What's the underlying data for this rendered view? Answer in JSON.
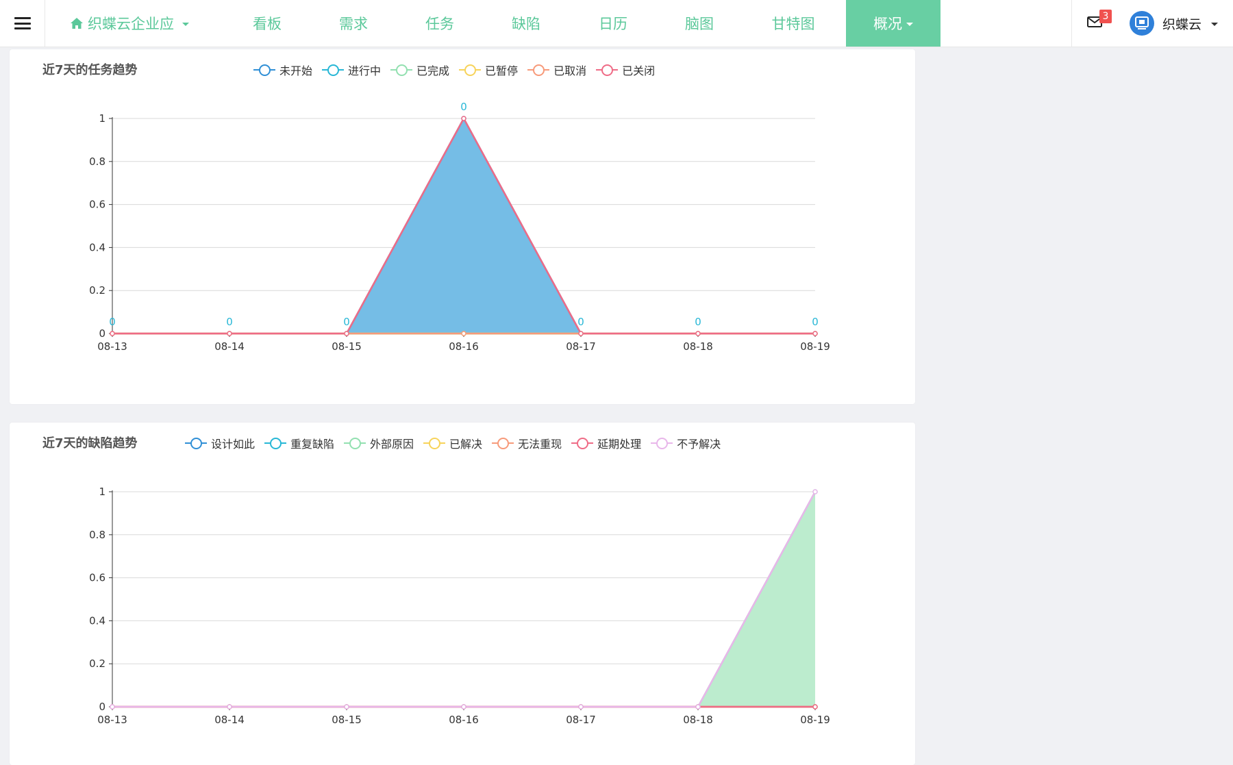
{
  "nav": {
    "app_name": "织蝶云企业应",
    "tabs": [
      "看板",
      "需求",
      "任务",
      "缺陷",
      "日历",
      "脑图",
      "甘特图"
    ],
    "active_tab": "概况",
    "notifications_count": "3",
    "username": "织蝶云"
  },
  "colors": {
    "accent": "#5bc89a",
    "active_tab_bg": "#68cfa3"
  },
  "task_card": {
    "title": "近7天的任务趋势"
  },
  "defect_card": {
    "title": "近7天的缺陷趋势"
  },
  "chart_data": [
    {
      "type": "area",
      "title": "近7天的任务趋势",
      "categories": [
        "08-13",
        "08-14",
        "08-15",
        "08-16",
        "08-17",
        "08-18",
        "08-19"
      ],
      "ylim": [
        0,
        1
      ],
      "yticks": [
        "0",
        "0.2",
        "0.4",
        "0.6",
        "0.8",
        "1"
      ],
      "grid": true,
      "legend_position": "top",
      "series": [
        {
          "name": "未开始",
          "color": "#2f8fd6",
          "values": [
            0,
            0,
            0,
            1,
            0,
            0,
            0
          ],
          "fill": "#75bde6"
        },
        {
          "name": "进行中",
          "color": "#27b7d6",
          "values": [
            0,
            0,
            0,
            0,
            0,
            0,
            0
          ]
        },
        {
          "name": "已完成",
          "color": "#92e0b0",
          "values": [
            0,
            0,
            0,
            0,
            0,
            0,
            0
          ]
        },
        {
          "name": "已暂停",
          "color": "#f7d35a",
          "values": [
            0,
            0,
            0,
            0,
            0,
            0,
            0
          ]
        },
        {
          "name": "已取消",
          "color": "#f79a7a",
          "values": [
            0,
            0,
            0,
            0,
            0,
            0,
            0
          ]
        },
        {
          "name": "已关闭",
          "color": "#ef6b86",
          "values": [
            0,
            0,
            0,
            1,
            0,
            0,
            0
          ],
          "top_line": true
        }
      ],
      "data_labels": [
        "0",
        "0",
        "0",
        "0",
        "0",
        "0",
        "0"
      ],
      "data_label_color": "#27b7d6"
    },
    {
      "type": "area",
      "title": "近7天的缺陷趋势",
      "categories": [
        "08-13",
        "08-14",
        "08-15",
        "08-16",
        "08-17",
        "08-18",
        "08-19"
      ],
      "ylim": [
        0,
        1
      ],
      "yticks": [
        "0",
        "0.2",
        "0.4",
        "0.6",
        "0.8",
        "1"
      ],
      "grid": true,
      "legend_position": "top",
      "series": [
        {
          "name": "设计如此",
          "color": "#2f8fd6",
          "values": [
            0,
            0,
            0,
            0,
            0,
            0,
            0
          ]
        },
        {
          "name": "重复缺陷",
          "color": "#27b7d6",
          "values": [
            0,
            0,
            0,
            0,
            0,
            0,
            0
          ]
        },
        {
          "name": "外部原因",
          "color": "#92e0b0",
          "values": [
            0,
            0,
            0,
            0,
            0,
            0,
            1
          ],
          "fill": "#bcecce"
        },
        {
          "name": "已解决",
          "color": "#f7d35a",
          "values": [
            0,
            0,
            0,
            0,
            0,
            0,
            0
          ]
        },
        {
          "name": "无法重现",
          "color": "#f79a7a",
          "values": [
            0,
            0,
            0,
            0,
            0,
            0,
            0
          ]
        },
        {
          "name": "延期处理",
          "color": "#ef6b86",
          "values": [
            0,
            0,
            0,
            0,
            0,
            0,
            0
          ]
        },
        {
          "name": "不予解决",
          "color": "#e8b6ea",
          "values": [
            0,
            0,
            0,
            0,
            0,
            0,
            1
          ],
          "top_line": true
        }
      ]
    }
  ]
}
